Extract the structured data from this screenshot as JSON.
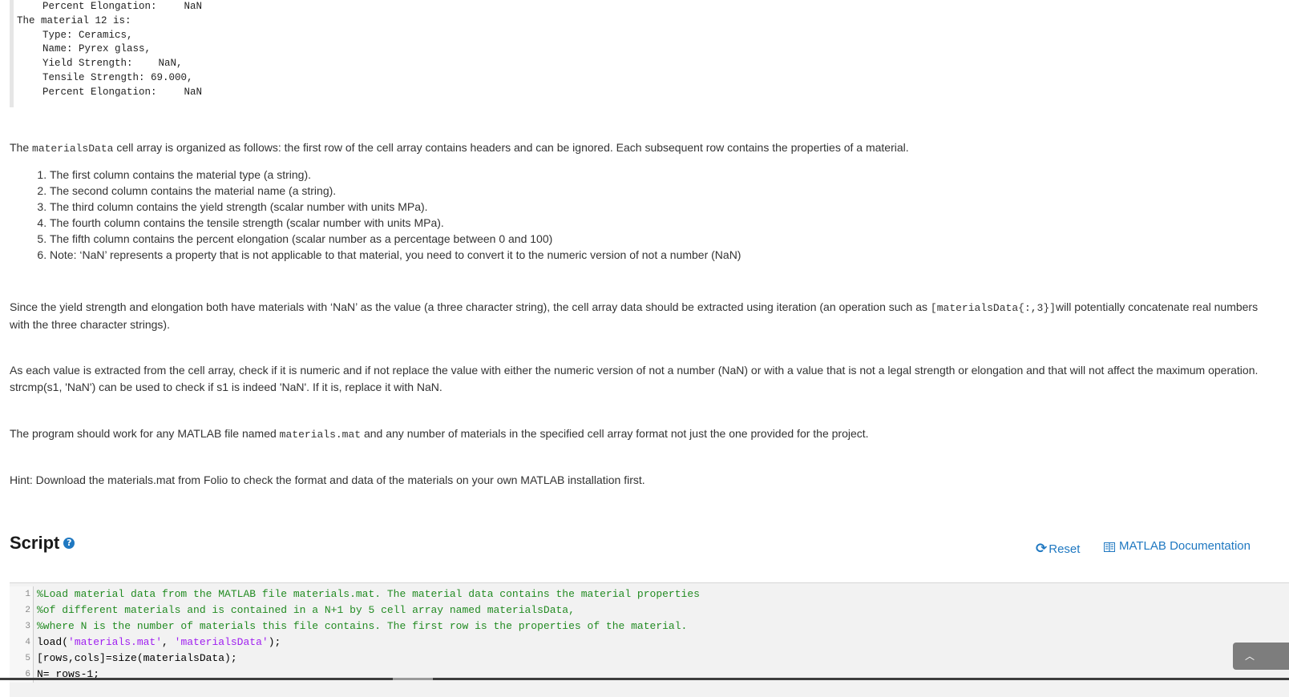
{
  "output": {
    "lines": [
      {
        "indent": true,
        "label": "Percent Elongation:",
        "value": "NaN"
      },
      {
        "indent": false,
        "label": "The material 12 is:",
        "value": ""
      },
      {
        "indent": true,
        "label": "Type: Ceramics,",
        "value": ""
      },
      {
        "indent": true,
        "label": "Name: Pyrex glass,",
        "value": ""
      },
      {
        "indent": true,
        "label": "Yield Strength:",
        "value": "NaN,"
      },
      {
        "indent": true,
        "label": "Tensile Strength: 69.000,",
        "value": ""
      },
      {
        "indent": true,
        "label": "Percent Elongation:",
        "value": "NaN"
      }
    ]
  },
  "intro": {
    "pre": "The ",
    "code": "materialsData",
    "post": " cell array is organized as follows: the first row of the cell array contains headers and can be ignored. Each subsequent row contains the properties of a material."
  },
  "list_items": [
    "The first column contains the material type (a string).",
    "The second column contains the material name (a string).",
    "The third column contains the yield strength (scalar number with units MPa).",
    "The fourth column contains the tensile strength (scalar number with units MPa).",
    "The fifth column contains the percent elongation (scalar number as a percentage between 0 and 100)",
    "Note: ‘NaN’ represents a property that is not applicable to that material, you need to convert it to  the numeric version of not a number (NaN)"
  ],
  "para_iteration": {
    "pre": "Since the yield strength and elongation both have materials with ‘NaN’ as the value (a three character string), the cell array data should be extracted using iteration (an operation such as ",
    "code": "[materialsData{:,3}]",
    "post": "will potentially concatenate real numbers with the three character strings)."
  },
  "para_check": "As each value is extracted from the cell array, check if it is numeric and if not replace the value with either the numeric version of not a number (NaN) or with a value that is not a legal strength or elongation and that will not affect the maximum operation. strcmp(s1, 'NaN') can be used to check if s1 is indeed 'NaN'. If it is, replace it with NaN.",
  "para_program": {
    "pre": "The program should work for any MATLAB file named ",
    "code": "materials.mat",
    "post": " and any number of materials in the specified cell array format not just the one provided for the project."
  },
  "para_hint": "Hint: Download the materials.mat from Folio to check the format and data of the materials on your own MATLAB installation first.",
  "script": {
    "title": "Script",
    "help_icon": "?",
    "reset_label": "Reset",
    "doc_label": "MATLAB Documentation"
  },
  "code_lines": [
    {
      "num": "1",
      "parts": [
        {
          "t": "cmt",
          "s": "%Load material data from the MATLAB file materials.mat. The material data contains the material properties"
        }
      ]
    },
    {
      "num": "2",
      "parts": [
        {
          "t": "cmt",
          "s": "%of different materials and is contained in a N+1 by 5 cell array named materialsData,"
        }
      ]
    },
    {
      "num": "3",
      "parts": [
        {
          "t": "cmt",
          "s": "%where N is the number of materials this file contains. The first row is the properties of the material."
        }
      ]
    },
    {
      "num": "4",
      "parts": [
        {
          "t": "",
          "s": "load("
        },
        {
          "t": "str",
          "s": "'materials.mat'"
        },
        {
          "t": "",
          "s": ", "
        },
        {
          "t": "str",
          "s": "'materialsData'"
        },
        {
          "t": "",
          "s": ");"
        }
      ]
    },
    {
      "num": "5",
      "parts": [
        {
          "t": "",
          "s": "[rows,cols]=size(materialsData);"
        }
      ]
    },
    {
      "num": "6",
      "parts": [
        {
          "t": "",
          "s": "N= rows-1;"
        }
      ]
    }
  ],
  "scroll_button_icon": "chevron-up-icon"
}
